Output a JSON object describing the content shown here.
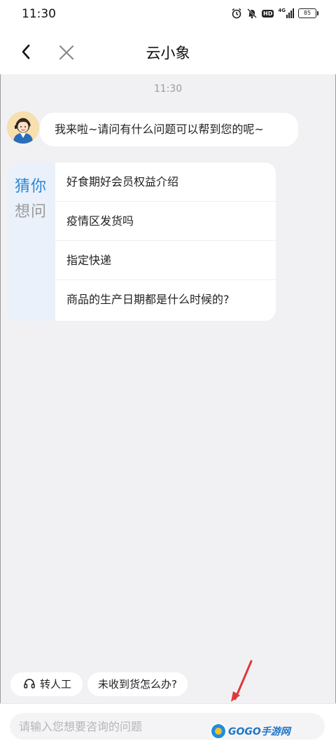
{
  "status_bar": {
    "time": "11:30",
    "battery": "85",
    "network": "4G",
    "hd": "HD"
  },
  "nav": {
    "title": "云小象"
  },
  "chat": {
    "timestamp": "11:30",
    "bot_message": "我来啦~请问有什么问题可以帮到您的呢~",
    "suggest": {
      "side_line1": "猜你",
      "side_line2": "想问",
      "items": [
        "好食期好会员权益介绍",
        "疫情区发货吗",
        "指定快递",
        "商品的生产日期都是什么时候的?"
      ]
    }
  },
  "quick_actions": {
    "human": "转人工",
    "no_receive": "未收到货怎么办?"
  },
  "input": {
    "placeholder": "请输入您想要咨询的问题"
  },
  "watermark": {
    "text": "GOGO手游网"
  },
  "colors": {
    "accent": "#2a88d8",
    "annotation_arrow": "#e0383a"
  }
}
